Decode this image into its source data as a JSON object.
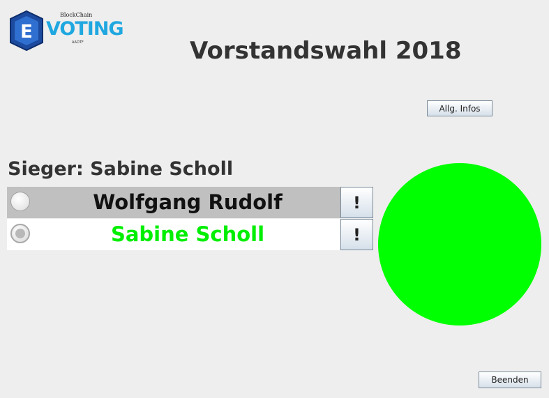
{
  "logo": {
    "letter": "E",
    "top_text": "BlockChain",
    "main_text": "VOTING",
    "bottom_text": "AADTF"
  },
  "title": "Vorstandswahl 2018",
  "buttons": {
    "infos_label": "Allg. Infos",
    "exit_label": "Beenden"
  },
  "winner_text": "Sieger: Sabine Scholl",
  "candidates": [
    {
      "name": "Wolfgang Rudolf",
      "selected": false,
      "info_label": "!",
      "color": "#111111"
    },
    {
      "name": "Sabine Scholl",
      "selected": true,
      "info_label": "!",
      "color": "#00ee00"
    }
  ],
  "result": {
    "color": "#00ff00"
  }
}
